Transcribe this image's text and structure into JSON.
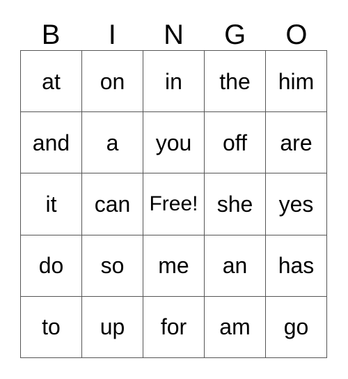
{
  "card": {
    "title": "BINGO",
    "headers": [
      "B",
      "I",
      "N",
      "G",
      "O"
    ],
    "free_space_label": "Free!",
    "colors": {
      "background": "#ffffff",
      "cell_background": "#ffffff",
      "border": "#555555",
      "text": "#000000"
    },
    "rows": [
      {
        "cells": [
          {
            "text": "at",
            "column": "B",
            "free": false
          },
          {
            "text": "on",
            "column": "I",
            "free": false
          },
          {
            "text": "in",
            "column": "N",
            "free": false
          },
          {
            "text": "the",
            "column": "G",
            "free": false
          },
          {
            "text": "him",
            "column": "O",
            "free": false
          }
        ]
      },
      {
        "cells": [
          {
            "text": "and",
            "column": "B",
            "free": false
          },
          {
            "text": "a",
            "column": "I",
            "free": false
          },
          {
            "text": "you",
            "column": "N",
            "free": false
          },
          {
            "text": "off",
            "column": "G",
            "free": false
          },
          {
            "text": "are",
            "column": "O",
            "free": false
          }
        ]
      },
      {
        "cells": [
          {
            "text": "it",
            "column": "B",
            "free": false
          },
          {
            "text": "can",
            "column": "I",
            "free": false
          },
          {
            "text": "Free!",
            "column": "N",
            "free": true
          },
          {
            "text": "she",
            "column": "G",
            "free": false
          },
          {
            "text": "yes",
            "column": "O",
            "free": false
          }
        ]
      },
      {
        "cells": [
          {
            "text": "do",
            "column": "B",
            "free": false
          },
          {
            "text": "so",
            "column": "I",
            "free": false
          },
          {
            "text": "me",
            "column": "N",
            "free": false
          },
          {
            "text": "an",
            "column": "G",
            "free": false
          },
          {
            "text": "has",
            "column": "O",
            "free": false
          }
        ]
      },
      {
        "cells": [
          {
            "text": "to",
            "column": "B",
            "free": false
          },
          {
            "text": "up",
            "column": "I",
            "free": false
          },
          {
            "text": "for",
            "column": "N",
            "free": false
          },
          {
            "text": "am",
            "column": "G",
            "free": false
          },
          {
            "text": "go",
            "column": "O",
            "free": false
          }
        ]
      }
    ]
  }
}
